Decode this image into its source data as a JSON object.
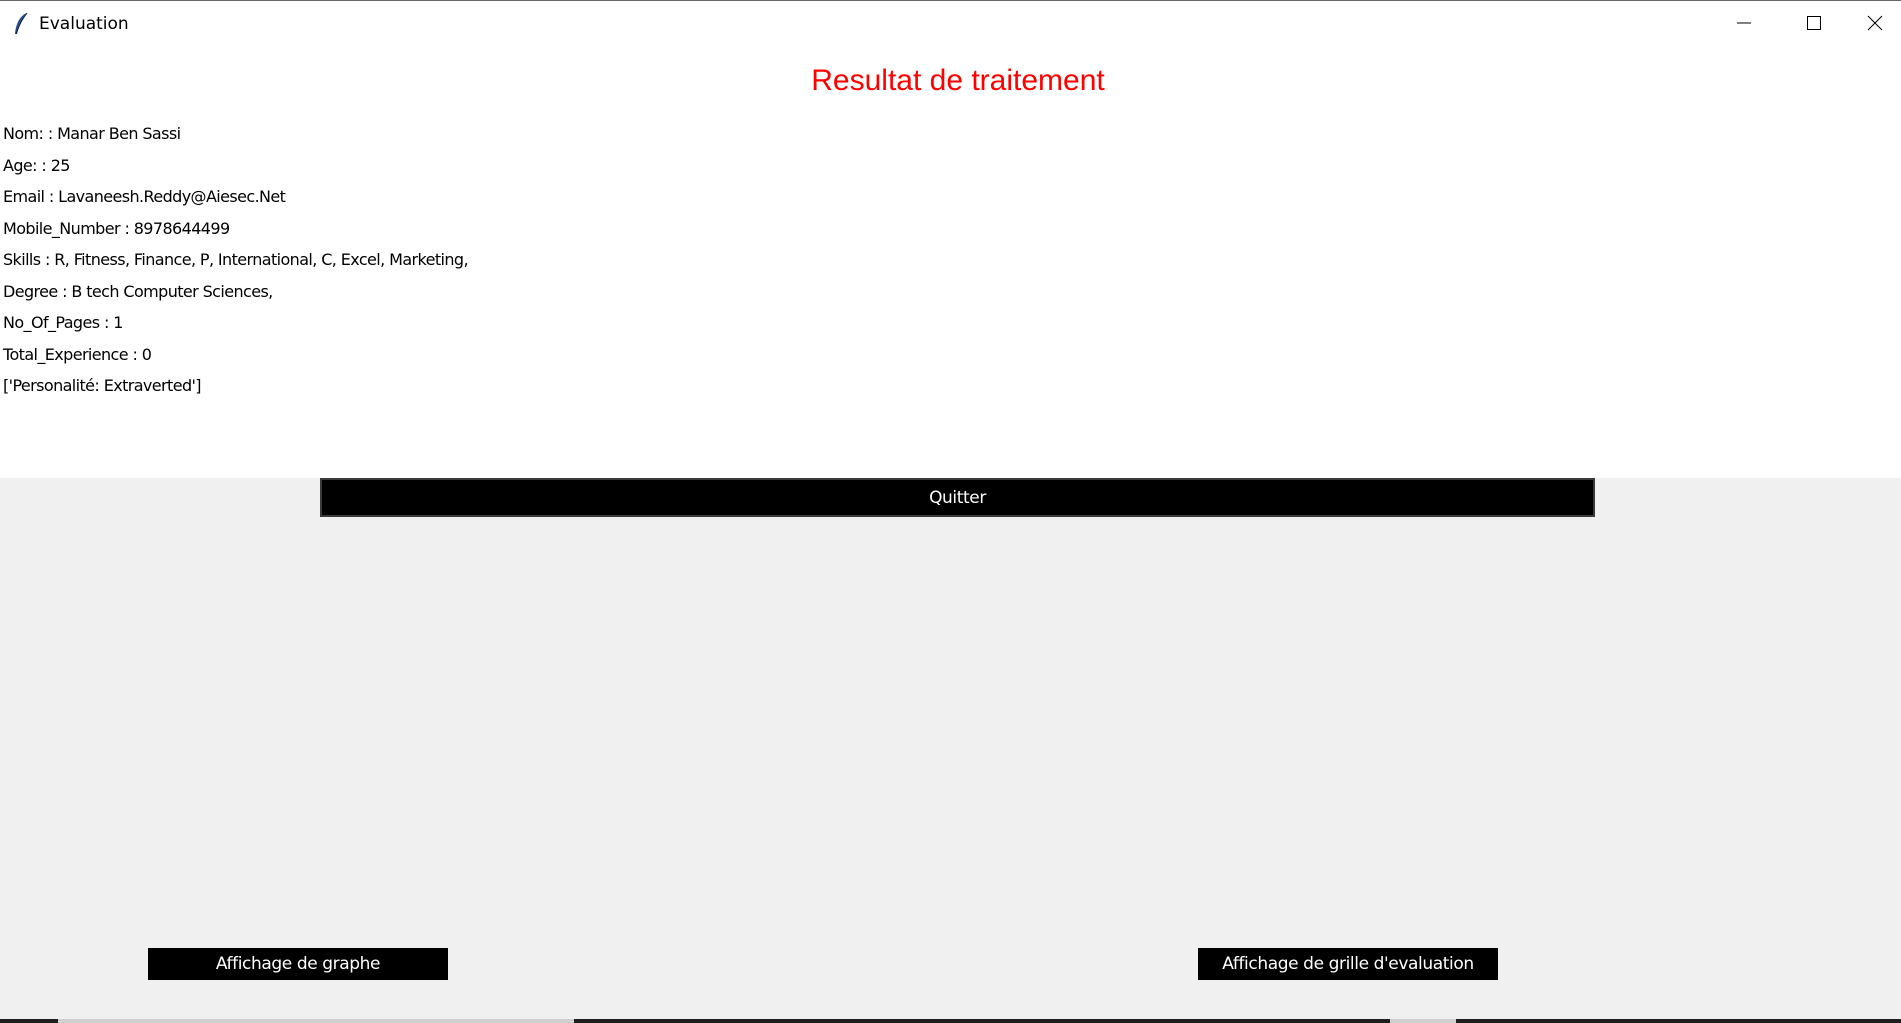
{
  "window": {
    "title": "Evaluation"
  },
  "result": {
    "heading": "Resultat de traitement",
    "heading_color": "#ff0000",
    "lines": [
      "Nom: : Manar Ben Sassi",
      "Age: : 25",
      "Email : Lavaneesh.Reddy@Aiesec.Net",
      "Mobile_Number : 8978644499",
      "Skills : R, Fitness, Finance, P, International, C, Excel, Marketing,",
      "Degree : B tech Computer Sciences,",
      "No_Of_Pages : 1",
      "Total_Experience : 0",
      "['Personalité: Extraverted']"
    ]
  },
  "buttons": {
    "quit_label": "Quitter",
    "graph_label": "Affichage de graphe",
    "grid_label": "Affichage de grille d'evaluation"
  },
  "icons": {
    "app": "feather-icon",
    "minimize": "minimize-icon",
    "maximize": "maximize-icon",
    "close": "close-icon"
  }
}
